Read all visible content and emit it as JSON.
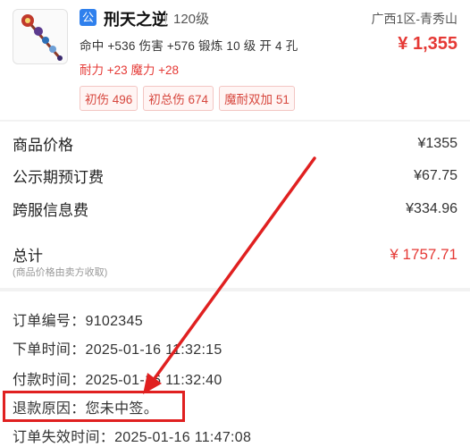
{
  "product": {
    "badge": "公",
    "name": "刑天之逆",
    "level": "120级",
    "server": "广西1区-青秀山",
    "price": "¥ 1,355",
    "stats": "命中 +536 伤害 +576 锻炼 10 级 开 4 孔",
    "stats_bonus": "耐力 +23 魔力 +28",
    "tags": [
      "初伤 496",
      "初总伤 674",
      "魔耐双加 51"
    ],
    "icon": "staff-weapon-icon"
  },
  "pricing": {
    "rows": [
      {
        "label": "商品价格",
        "value": "¥1355"
      },
      {
        "label": "公示期预订费",
        "value": "¥67.75"
      },
      {
        "label": "跨服信息费",
        "value": "¥334.96"
      }
    ],
    "total_label": "总计",
    "total_value": "¥ 1757.71",
    "note": "(商品价格由卖方收取)"
  },
  "order": {
    "rows": [
      "订单编号：9102345",
      "下单时间：2025-01-16 11:32:15",
      "付款时间：2025-01-16 11:32:40",
      "退款原因：您未中签。",
      "订单失效时间：2025-01-16 11:47:08"
    ]
  },
  "colors": {
    "accent_red": "#e53935",
    "annotation_red": "#e02020",
    "badge_blue": "#2f80ed"
  }
}
